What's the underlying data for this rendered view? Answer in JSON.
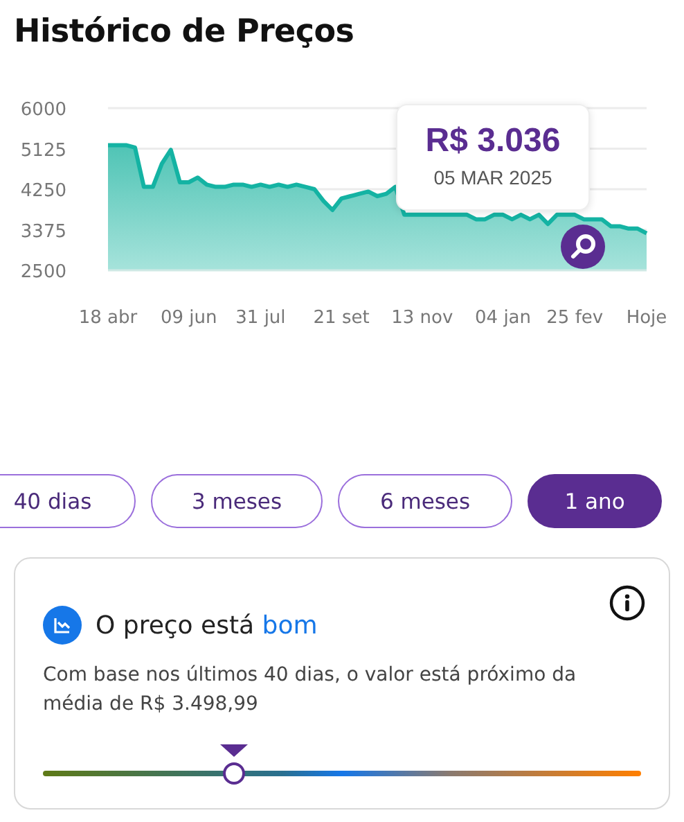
{
  "title": "Histórico de Preços",
  "chart": {
    "chart_data": {
      "type": "area",
      "categories": [
        "18 abr",
        null,
        null,
        null,
        null,
        null,
        null,
        null,
        null,
        "09 jun",
        null,
        null,
        null,
        null,
        null,
        null,
        null,
        "31 jul",
        null,
        null,
        null,
        null,
        null,
        null,
        null,
        null,
        "21 set",
        null,
        null,
        null,
        null,
        null,
        null,
        null,
        null,
        "13 nov",
        null,
        null,
        null,
        null,
        null,
        null,
        null,
        null,
        "04 jan",
        null,
        null,
        null,
        null,
        null,
        null,
        null,
        "25 fev",
        null,
        null,
        null,
        null,
        null,
        null,
        null,
        "Hoje"
      ],
      "series": [
        {
          "color": "#14b3a3",
          "values": [
            5200,
            5200,
            5200,
            5150,
            4300,
            4300,
            4800,
            5100,
            4400,
            4400,
            4500,
            4350,
            4300,
            4300,
            4350,
            4350,
            4300,
            4350,
            4300,
            4350,
            4300,
            4350,
            4300,
            4250,
            4000,
            3800,
            4050,
            4100,
            4150,
            4200,
            4100,
            4150,
            4300,
            3700,
            3700,
            3700,
            3700,
            3700,
            3700,
            3700,
            3700,
            3600,
            3600,
            3700,
            3700,
            3600,
            3700,
            3600,
            3700,
            3500,
            3700,
            3700,
            3700,
            3600,
            3600,
            3600,
            3450,
            3450,
            3400,
            3400,
            3300
          ]
        }
      ],
      "grid": true,
      "ylim": [
        2500,
        6000
      ],
      "yticks": [
        2500,
        3375,
        4250,
        5125,
        6000
      ]
    },
    "tooltip": {
      "price": "R$ 3.036",
      "date": "05 MAR 2025"
    }
  },
  "periods": [
    {
      "label": "40 dias",
      "selected": false
    },
    {
      "label": "3 meses",
      "selected": false
    },
    {
      "label": "6 meses",
      "selected": false
    },
    {
      "label": "1 ano",
      "selected": true
    }
  ],
  "price_card": {
    "title": "O preço está",
    "rating": "bom",
    "description": "Com base nos últimos 40 dias, o valor está próximo da média de R$ 3.498,99",
    "meter": {
      "level": 0.32
    }
  }
}
